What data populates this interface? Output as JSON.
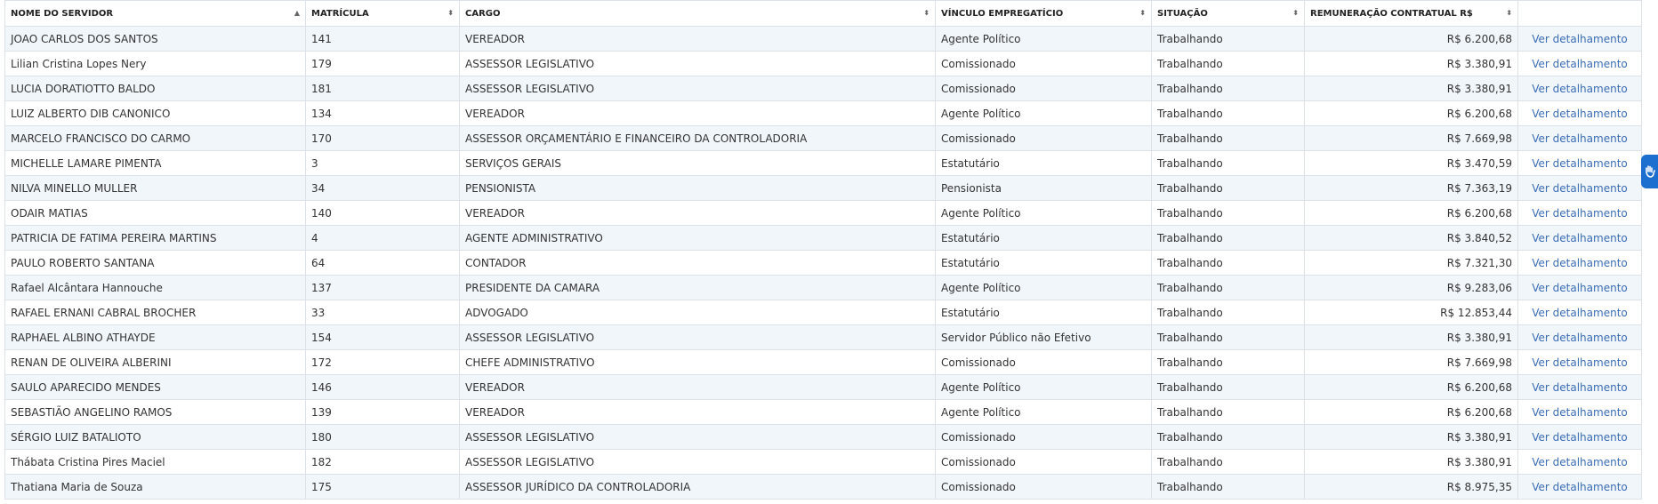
{
  "table": {
    "headers": [
      {
        "label": "NOME DO SERVIDOR",
        "sort": "asc"
      },
      {
        "label": "MATRÍCULA",
        "sort": "both"
      },
      {
        "label": "CARGO",
        "sort": "both"
      },
      {
        "label": "VÍNCULO EMPREGATÍCIO",
        "sort": "both"
      },
      {
        "label": "SITUAÇÃO",
        "sort": "both"
      },
      {
        "label": "REMUNERAÇÃO CONTRATUAL R$",
        "sort": "both"
      },
      {
        "label": "",
        "sort": "none"
      }
    ],
    "rows": [
      [
        "JOAO CARLOS DOS SANTOS",
        "141",
        "VEREADOR",
        "Agente Político",
        "Trabalhando",
        "R$ 6.200,68",
        "Ver detalhamento"
      ],
      [
        "Lilian Cristina Lopes Nery",
        "179",
        "ASSESSOR LEGISLATIVO",
        "Comissionado",
        "Trabalhando",
        "R$ 3.380,91",
        "Ver detalhamento"
      ],
      [
        "LUCIA DORATIOTTO BALDO",
        "181",
        "ASSESSOR LEGISLATIVO",
        "Comissionado",
        "Trabalhando",
        "R$ 3.380,91",
        "Ver detalhamento"
      ],
      [
        "LUIZ ALBERTO DIB CANONICO",
        "134",
        "VEREADOR",
        "Agente Político",
        "Trabalhando",
        "R$ 6.200,68",
        "Ver detalhamento"
      ],
      [
        "MARCELO FRANCISCO DO CARMO",
        "170",
        "ASSESSOR ORÇAMENTÁRIO E FINANCEIRO DA CONTROLADORIA",
        "Comissionado",
        "Trabalhando",
        "R$ 7.669,98",
        "Ver detalhamento"
      ],
      [
        "MICHELLE LAMARE PIMENTA",
        "3",
        "SERVIÇOS GERAIS",
        "Estatutário",
        "Trabalhando",
        "R$ 3.470,59",
        "Ver detalhamento"
      ],
      [
        "NILVA MINELLO MULLER",
        "34",
        "PENSIONISTA",
        "Pensionista",
        "Trabalhando",
        "R$ 7.363,19",
        "Ver detalhamento"
      ],
      [
        "ODAIR MATIAS",
        "140",
        "VEREADOR",
        "Agente Político",
        "Trabalhando",
        "R$ 6.200,68",
        "Ver detalhamento"
      ],
      [
        "PATRICIA DE FATIMA PEREIRA MARTINS",
        "4",
        "AGENTE ADMINISTRATIVO",
        "Estatutário",
        "Trabalhando",
        "R$ 3.840,52",
        "Ver detalhamento"
      ],
      [
        "PAULO ROBERTO SANTANA",
        "64",
        "CONTADOR",
        "Estatutário",
        "Trabalhando",
        "R$ 7.321,30",
        "Ver detalhamento"
      ],
      [
        "Rafael Alcântara Hannouche",
        "137",
        "PRESIDENTE DA CAMARA",
        "Agente Político",
        "Trabalhando",
        "R$ 9.283,06",
        "Ver detalhamento"
      ],
      [
        "RAFAEL ERNANI CABRAL BROCHER",
        "33",
        "ADVOGADO",
        "Estatutário",
        "Trabalhando",
        "R$ 12.853,44",
        "Ver detalhamento"
      ],
      [
        "RAPHAEL ALBINO ATHAYDE",
        "154",
        "ASSESSOR LEGISLATIVO",
        "Servidor Público não Efetivo",
        "Trabalhando",
        "R$ 3.380,91",
        "Ver detalhamento"
      ],
      [
        "RENAN DE OLIVEIRA ALBERINI",
        "172",
        "CHEFE ADMINISTRATIVO",
        "Comissionado",
        "Trabalhando",
        "R$ 7.669,98",
        "Ver detalhamento"
      ],
      [
        "SAULO APARECIDO MENDES",
        "146",
        "VEREADOR",
        "Agente Político",
        "Trabalhando",
        "R$ 6.200,68",
        "Ver detalhamento"
      ],
      [
        "SEBASTIÃO ANGELINO RAMOS",
        "139",
        "VEREADOR",
        "Agente Político",
        "Trabalhando",
        "R$ 6.200,68",
        "Ver detalhamento"
      ],
      [
        "SÉRGIO LUIZ BATALIOTO",
        "180",
        "ASSESSOR LEGISLATIVO",
        "Comissionado",
        "Trabalhando",
        "R$ 3.380,91",
        "Ver detalhamento"
      ],
      [
        "Thábata Cristina Pires Maciel",
        "182",
        "ASSESSOR LEGISLATIVO",
        "Comissionado",
        "Trabalhando",
        "R$ 3.380,91",
        "Ver detalhamento"
      ],
      [
        "Thatiana Maria de Souza",
        "175",
        "ASSESSOR JURÍDICO DA CONTROLADORIA",
        "Comissionado",
        "Trabalhando",
        "R$ 8.975,35",
        "Ver detalhamento"
      ]
    ]
  },
  "colors": {
    "link": "#3a6db5",
    "row_alt": "#f1f6fb",
    "accessibility_widget": "#1d6fcf"
  },
  "icons": {
    "sort_asc": "sort-asc-icon",
    "sort_both": "sort-icon",
    "accessibility": "sign-language-hands-icon"
  }
}
